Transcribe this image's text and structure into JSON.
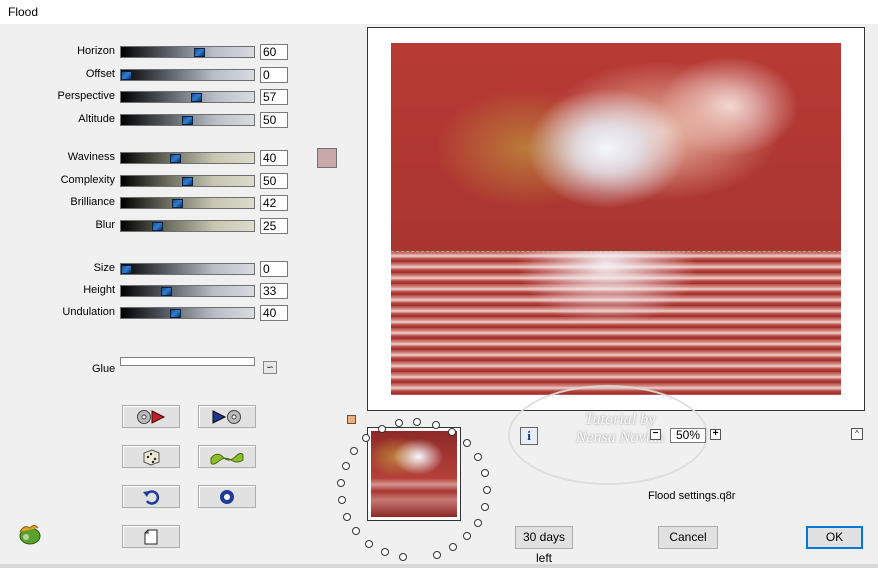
{
  "window": {
    "title": "Flood"
  },
  "sliders_group1": [
    {
      "label": "Horizon",
      "value": "60",
      "pos": 60,
      "style": "grey"
    },
    {
      "label": "Offset",
      "value": "0",
      "pos": 0,
      "style": "grey"
    },
    {
      "label": "Perspective",
      "value": "57",
      "pos": 57,
      "style": "grey"
    },
    {
      "label": "Altitude",
      "value": "50",
      "pos": 50,
      "style": "grey"
    }
  ],
  "sliders_group2": [
    {
      "label": "Waviness",
      "value": "40",
      "pos": 40,
      "style": "olive"
    },
    {
      "label": "Complexity",
      "value": "50",
      "pos": 50,
      "style": "olive"
    },
    {
      "label": "Brilliance",
      "value": "42",
      "pos": 42,
      "style": "olive"
    },
    {
      "label": "Blur",
      "value": "25",
      "pos": 25,
      "style": "olive"
    }
  ],
  "sliders_group3": [
    {
      "label": "Size",
      "value": "0",
      "pos": 0,
      "style": "grey"
    },
    {
      "label": "Height",
      "value": "33",
      "pos": 33,
      "style": "grey"
    },
    {
      "label": "Undulation",
      "value": "40",
      "pos": 40,
      "style": "grey"
    }
  ],
  "glue": {
    "label": "Glue",
    "link_icon": "link-icon"
  },
  "color_swatch": {
    "color": "#c8a8a8"
  },
  "tools": [
    {
      "name": "reset-to-default-button",
      "icon": "disc-arrow-icon"
    },
    {
      "name": "next-preset-button",
      "icon": "arrow-disc-icon"
    },
    {
      "name": "randomize-button",
      "icon": "dice-icon"
    },
    {
      "name": "wave-preset-button",
      "icon": "wave-icon"
    },
    {
      "name": "undo-button",
      "icon": "undo-icon"
    },
    {
      "name": "stop-button",
      "icon": "stop-icon"
    },
    {
      "name": "copy-button",
      "icon": "document-icon"
    }
  ],
  "watermark": {
    "line1": "Tutorial by",
    "line2": "Nensa Novias"
  },
  "zoom": {
    "value": "50%",
    "minus": "−",
    "plus": "+"
  },
  "collapse": {
    "glyph": "^"
  },
  "info": {
    "glyph": "i"
  },
  "settings_file": "Flood settings.q8r",
  "trial": {
    "label": "30 days left"
  },
  "cancel": {
    "label": "Cancel"
  },
  "ok": {
    "label": "OK"
  }
}
